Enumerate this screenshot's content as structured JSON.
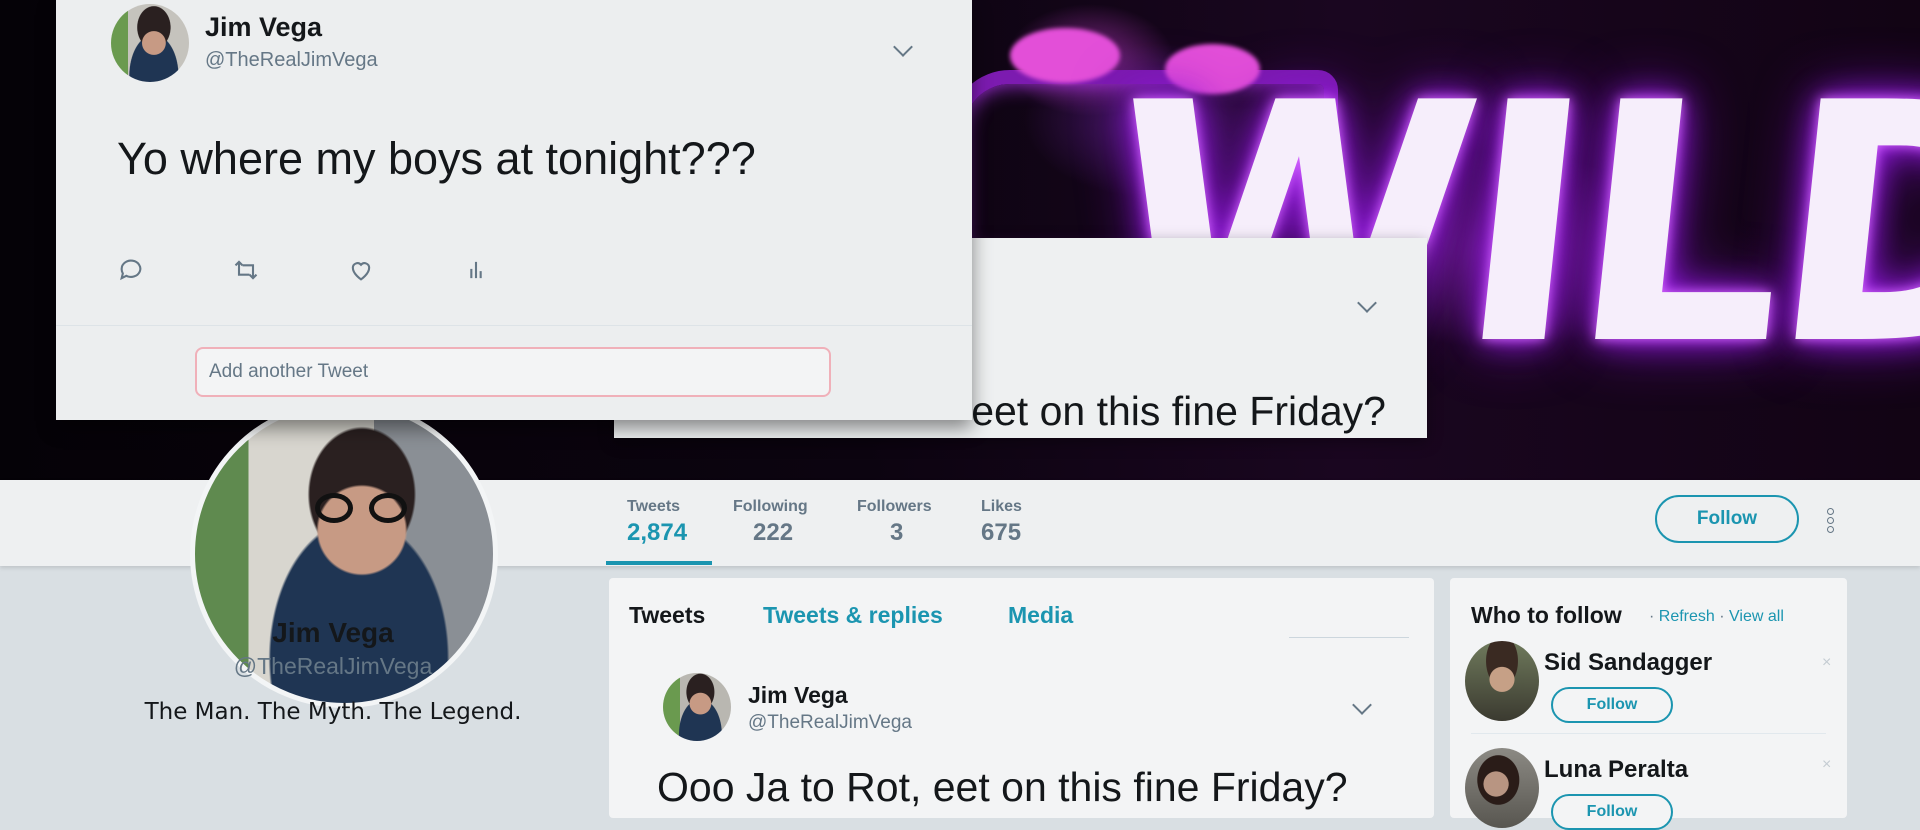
{
  "card1": {
    "name": "Jim Vega",
    "handle": "@TheRealJimVega",
    "text": "Yo where my boys at tonight???",
    "actions": [
      "reply-icon",
      "retweet-icon",
      "like-icon",
      "analytics-icon"
    ],
    "reply_placeholder": "Add another Tweet"
  },
  "card2": {
    "text": "eet on this fine Friday?"
  },
  "profile_nav": {
    "stats": [
      {
        "label": "Tweets",
        "value": "2,874"
      },
      {
        "label": "Following",
        "value": "222"
      },
      {
        "label": "Followers",
        "value": "3"
      },
      {
        "label": "Likes",
        "value": "675"
      }
    ],
    "follow_label": "Follow",
    "accent_color": "#1b95b0"
  },
  "profile": {
    "name": "Jim Vega",
    "handle": "@TheRealJimVega",
    "bio": "The Man. The Myth. The Legend."
  },
  "timeline": {
    "tabs": [
      "Tweets",
      "Tweets & replies",
      "Media"
    ],
    "tweet": {
      "name": "Jim Vega",
      "handle": "@TheRealJimVega",
      "text": "Ooo Ja to Rot, eet on this fine Friday?"
    }
  },
  "who_to_follow": {
    "title": "Who to follow",
    "refresh": "Refresh",
    "view_all": "View all",
    "separator": "·",
    "users": [
      {
        "name": "Sid Sandagger",
        "follow_label": "Follow"
      },
      {
        "name": "Luna Peralta",
        "follow_label": "Follow"
      }
    ],
    "dismiss": "×"
  },
  "banner": {
    "neon_text": "WILD"
  }
}
